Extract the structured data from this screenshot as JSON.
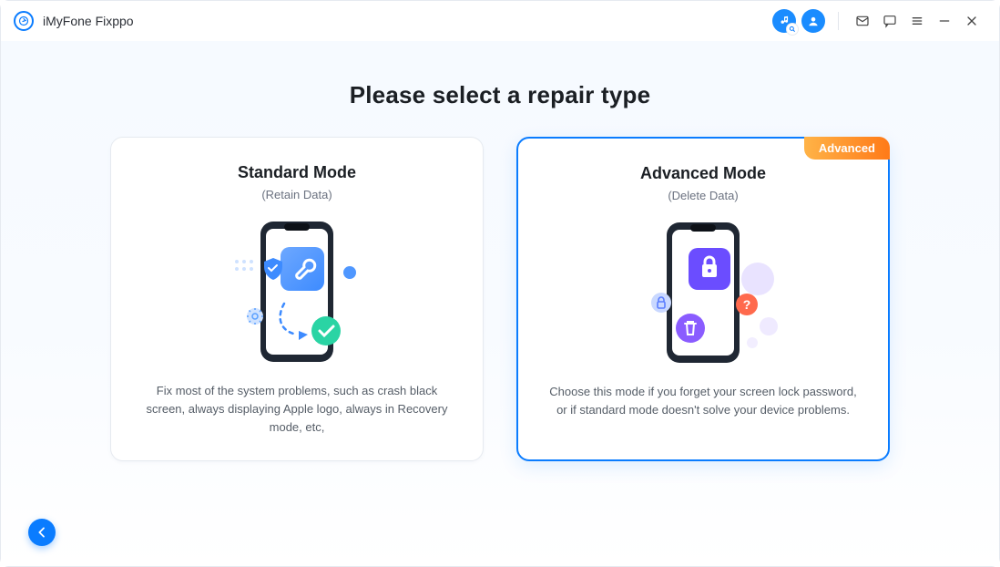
{
  "app": {
    "title": "iMyFone Fixppo"
  },
  "heading": "Please select a repair type",
  "cards": {
    "standard": {
      "title": "Standard Mode",
      "subtitle": "(Retain Data)",
      "desc": "Fix most of the system problems, such as crash black screen, always displaying Apple logo, always in Recovery mode, etc,"
    },
    "advanced": {
      "title": "Advanced Mode",
      "subtitle": "(Delete Data)",
      "desc": "Choose this mode if you forget your screen lock password, or if standard mode doesn't solve your device problems.",
      "badge": "Advanced"
    }
  }
}
